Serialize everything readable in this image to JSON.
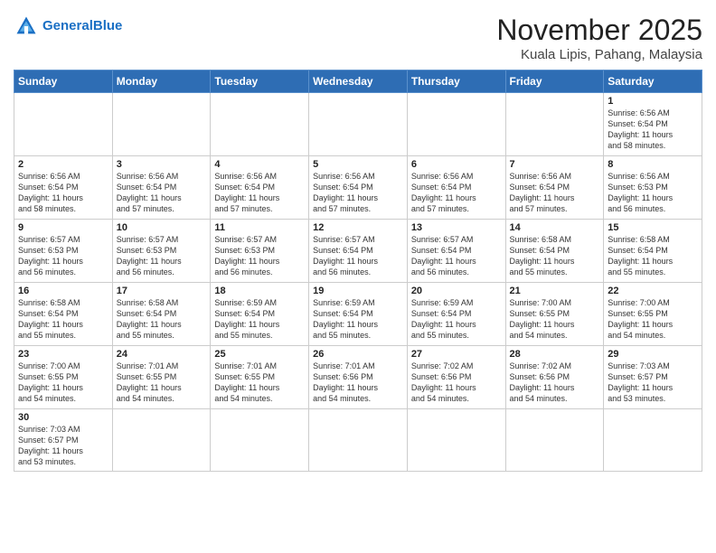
{
  "header": {
    "logo_general": "General",
    "logo_blue": "Blue",
    "title": "November 2025",
    "location": "Kuala Lipis, Pahang, Malaysia"
  },
  "weekdays": [
    "Sunday",
    "Monday",
    "Tuesday",
    "Wednesday",
    "Thursday",
    "Friday",
    "Saturday"
  ],
  "weeks": [
    [
      {
        "day": "",
        "info": ""
      },
      {
        "day": "",
        "info": ""
      },
      {
        "day": "",
        "info": ""
      },
      {
        "day": "",
        "info": ""
      },
      {
        "day": "",
        "info": ""
      },
      {
        "day": "",
        "info": ""
      },
      {
        "day": "1",
        "info": "Sunrise: 6:56 AM\nSunset: 6:54 PM\nDaylight: 11 hours\nand 58 minutes."
      }
    ],
    [
      {
        "day": "2",
        "info": "Sunrise: 6:56 AM\nSunset: 6:54 PM\nDaylight: 11 hours\nand 58 minutes."
      },
      {
        "day": "3",
        "info": "Sunrise: 6:56 AM\nSunset: 6:54 PM\nDaylight: 11 hours\nand 57 minutes."
      },
      {
        "day": "4",
        "info": "Sunrise: 6:56 AM\nSunset: 6:54 PM\nDaylight: 11 hours\nand 57 minutes."
      },
      {
        "day": "5",
        "info": "Sunrise: 6:56 AM\nSunset: 6:54 PM\nDaylight: 11 hours\nand 57 minutes."
      },
      {
        "day": "6",
        "info": "Sunrise: 6:56 AM\nSunset: 6:54 PM\nDaylight: 11 hours\nand 57 minutes."
      },
      {
        "day": "7",
        "info": "Sunrise: 6:56 AM\nSunset: 6:54 PM\nDaylight: 11 hours\nand 57 minutes."
      },
      {
        "day": "8",
        "info": "Sunrise: 6:56 AM\nSunset: 6:53 PM\nDaylight: 11 hours\nand 56 minutes."
      }
    ],
    [
      {
        "day": "9",
        "info": "Sunrise: 6:57 AM\nSunset: 6:53 PM\nDaylight: 11 hours\nand 56 minutes."
      },
      {
        "day": "10",
        "info": "Sunrise: 6:57 AM\nSunset: 6:53 PM\nDaylight: 11 hours\nand 56 minutes."
      },
      {
        "day": "11",
        "info": "Sunrise: 6:57 AM\nSunset: 6:53 PM\nDaylight: 11 hours\nand 56 minutes."
      },
      {
        "day": "12",
        "info": "Sunrise: 6:57 AM\nSunset: 6:54 PM\nDaylight: 11 hours\nand 56 minutes."
      },
      {
        "day": "13",
        "info": "Sunrise: 6:57 AM\nSunset: 6:54 PM\nDaylight: 11 hours\nand 56 minutes."
      },
      {
        "day": "14",
        "info": "Sunrise: 6:58 AM\nSunset: 6:54 PM\nDaylight: 11 hours\nand 55 minutes."
      },
      {
        "day": "15",
        "info": "Sunrise: 6:58 AM\nSunset: 6:54 PM\nDaylight: 11 hours\nand 55 minutes."
      }
    ],
    [
      {
        "day": "16",
        "info": "Sunrise: 6:58 AM\nSunset: 6:54 PM\nDaylight: 11 hours\nand 55 minutes."
      },
      {
        "day": "17",
        "info": "Sunrise: 6:58 AM\nSunset: 6:54 PM\nDaylight: 11 hours\nand 55 minutes."
      },
      {
        "day": "18",
        "info": "Sunrise: 6:59 AM\nSunset: 6:54 PM\nDaylight: 11 hours\nand 55 minutes."
      },
      {
        "day": "19",
        "info": "Sunrise: 6:59 AM\nSunset: 6:54 PM\nDaylight: 11 hours\nand 55 minutes."
      },
      {
        "day": "20",
        "info": "Sunrise: 6:59 AM\nSunset: 6:54 PM\nDaylight: 11 hours\nand 55 minutes."
      },
      {
        "day": "21",
        "info": "Sunrise: 7:00 AM\nSunset: 6:55 PM\nDaylight: 11 hours\nand 54 minutes."
      },
      {
        "day": "22",
        "info": "Sunrise: 7:00 AM\nSunset: 6:55 PM\nDaylight: 11 hours\nand 54 minutes."
      }
    ],
    [
      {
        "day": "23",
        "info": "Sunrise: 7:00 AM\nSunset: 6:55 PM\nDaylight: 11 hours\nand 54 minutes."
      },
      {
        "day": "24",
        "info": "Sunrise: 7:01 AM\nSunset: 6:55 PM\nDaylight: 11 hours\nand 54 minutes."
      },
      {
        "day": "25",
        "info": "Sunrise: 7:01 AM\nSunset: 6:55 PM\nDaylight: 11 hours\nand 54 minutes."
      },
      {
        "day": "26",
        "info": "Sunrise: 7:01 AM\nSunset: 6:56 PM\nDaylight: 11 hours\nand 54 minutes."
      },
      {
        "day": "27",
        "info": "Sunrise: 7:02 AM\nSunset: 6:56 PM\nDaylight: 11 hours\nand 54 minutes."
      },
      {
        "day": "28",
        "info": "Sunrise: 7:02 AM\nSunset: 6:56 PM\nDaylight: 11 hours\nand 54 minutes."
      },
      {
        "day": "29",
        "info": "Sunrise: 7:03 AM\nSunset: 6:57 PM\nDaylight: 11 hours\nand 53 minutes."
      }
    ],
    [
      {
        "day": "30",
        "info": "Sunrise: 7:03 AM\nSunset: 6:57 PM\nDaylight: 11 hours\nand 53 minutes."
      },
      {
        "day": "",
        "info": ""
      },
      {
        "day": "",
        "info": ""
      },
      {
        "day": "",
        "info": ""
      },
      {
        "day": "",
        "info": ""
      },
      {
        "day": "",
        "info": ""
      },
      {
        "day": "",
        "info": ""
      }
    ]
  ]
}
